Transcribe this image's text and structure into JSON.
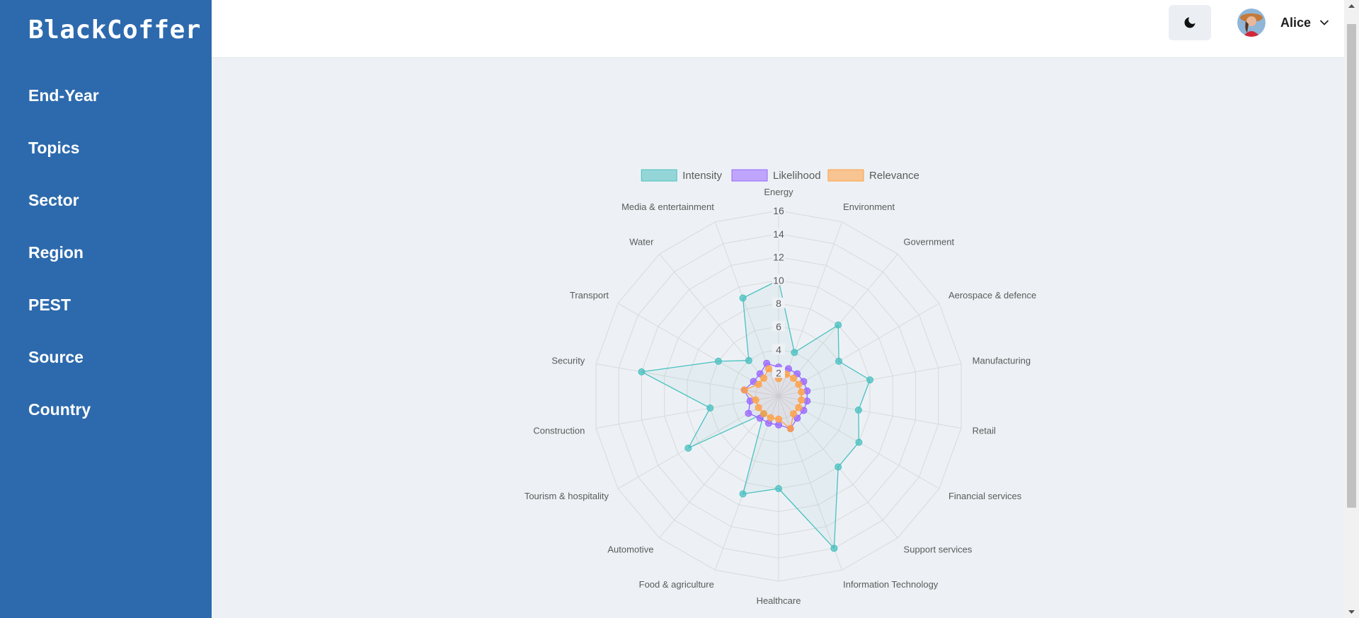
{
  "app": {
    "brand": "BlackCoffer"
  },
  "sidebar": {
    "items": [
      {
        "label": "End-Year"
      },
      {
        "label": "Topics"
      },
      {
        "label": "Sector"
      },
      {
        "label": "Region"
      },
      {
        "label": "PEST"
      },
      {
        "label": "Source"
      },
      {
        "label": "Country"
      }
    ]
  },
  "header": {
    "theme_icon": "moon-icon",
    "user": {
      "name": "Alice",
      "menu_icon": "chevron-down-icon"
    }
  },
  "colors": {
    "sidebar_bg": "#2d6aad",
    "page_bg": "#edf1f5",
    "intensity": "#4bc0c0",
    "likelihood": "#9966ff",
    "relevance": "#ff9f40"
  },
  "chart_data": {
    "type": "radar",
    "categories": [
      "Energy",
      "Environment",
      "Government",
      "Aerospace & defence",
      "Manufacturing",
      "Retail",
      "Financial services",
      "Support services",
      "Information Technology",
      "Healthcare",
      "Food & agriculture",
      "Automotive",
      "Tourism & hospitality",
      "Construction",
      "Security",
      "Transport",
      "Water",
      "Media & entertainment"
    ],
    "series": [
      {
        "name": "Intensity",
        "color": "#4bc0c0",
        "values": [
          10,
          4,
          8,
          6,
          8,
          7,
          8,
          8,
          14,
          8,
          9,
          2,
          9,
          6,
          12,
          6,
          4,
          9
        ]
      },
      {
        "name": "Likelihood",
        "color": "#9966ff",
        "values": [
          2.5,
          2.5,
          2.5,
          2.5,
          2.5,
          2.5,
          2.5,
          2.5,
          3,
          2.5,
          2.5,
          2.5,
          3,
          2.5,
          3,
          2.5,
          2.5,
          3
        ]
      },
      {
        "name": "Relevance",
        "color": "#ff9f40",
        "values": [
          1.5,
          2,
          2,
          2,
          2,
          2,
          2,
          2,
          3,
          2,
          2,
          2,
          2,
          2,
          3,
          2,
          2,
          2.5
        ]
      }
    ],
    "r_ticks": [
      2,
      4,
      6,
      8,
      10,
      12,
      14,
      16
    ],
    "rlim": [
      0,
      16
    ],
    "legend_position": "top",
    "grid": true
  }
}
